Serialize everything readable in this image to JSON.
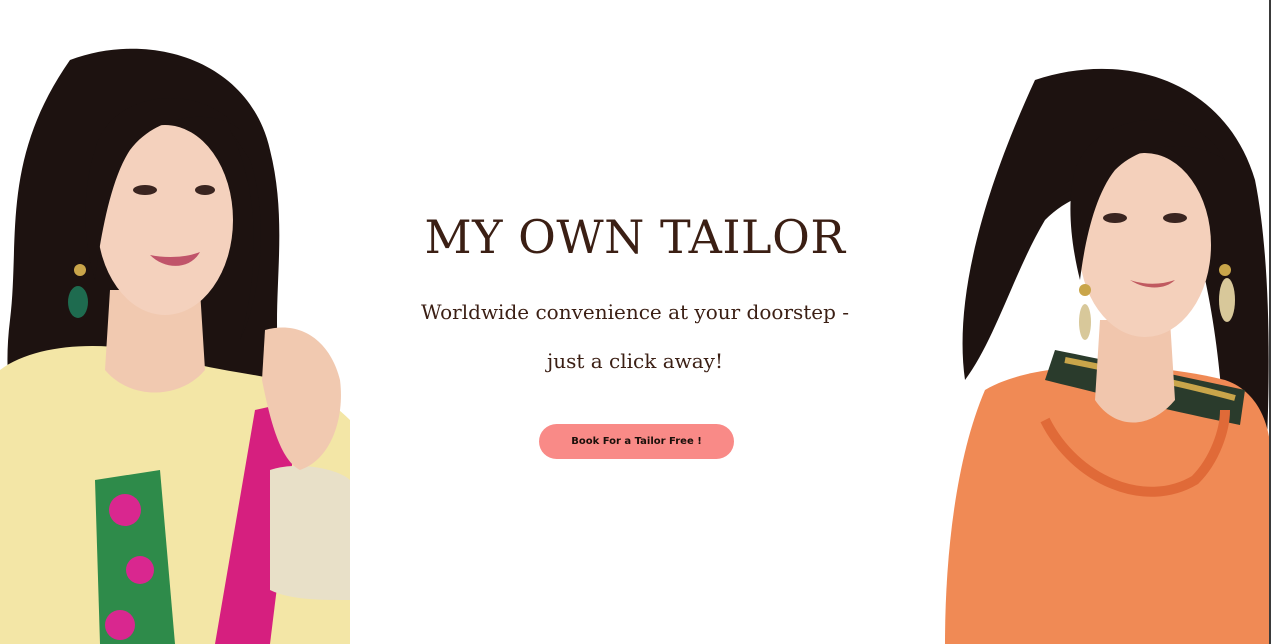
{
  "hero": {
    "title": "MY OWN TAILOR",
    "tagline_line1": "Worldwide convenience at your doorstep -",
    "tagline_line2": "just a click away!",
    "cta_label": "Book For a Tailor Free !"
  },
  "images": {
    "left": "woman-in-yellow-embroidered-suit-photo",
    "right": "woman-in-orange-embroidered-suit-photo"
  },
  "colors": {
    "title_text": "#3b1f14",
    "cta_background": "#f98a87",
    "page_background": "#ffffff"
  }
}
